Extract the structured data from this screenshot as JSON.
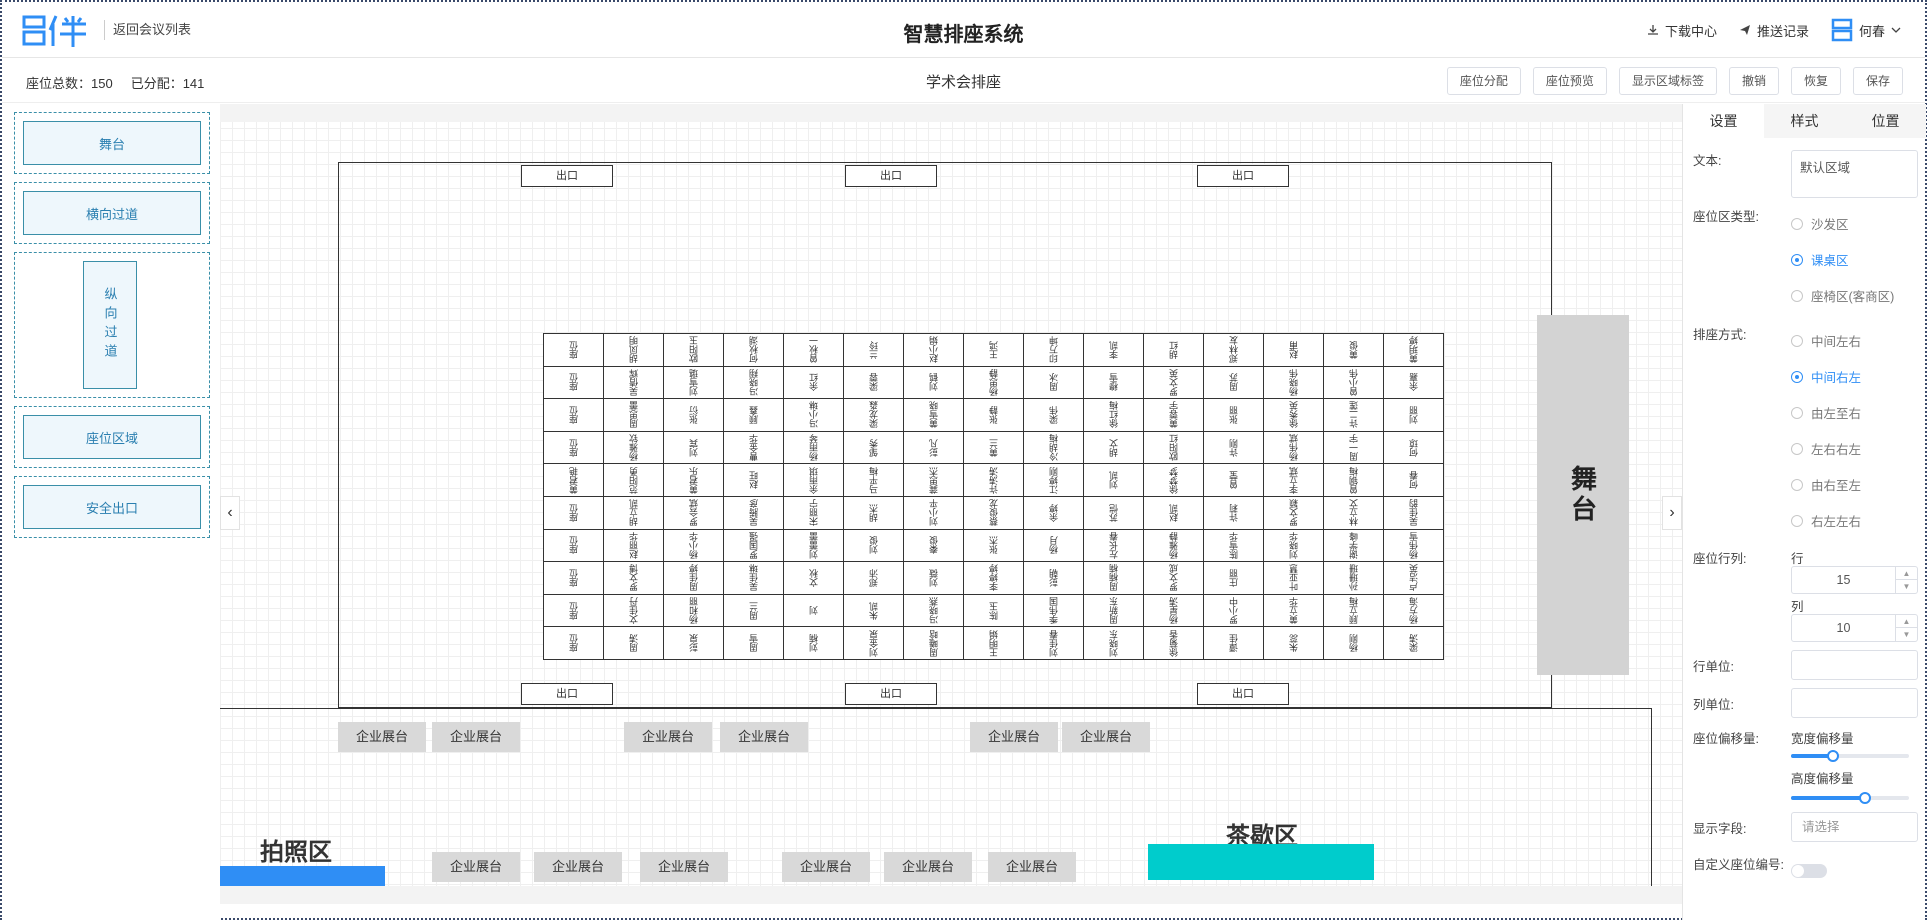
{
  "header": {
    "back_label": "返回会议列表",
    "title": "智慧排座系统",
    "download_label": "下载中心",
    "push_label": "推送记录",
    "user_name": "何春",
    "logo_text": "吕伴"
  },
  "toolbar": {
    "total_label": "座位总数：150",
    "assigned_label": "已分配：141",
    "sub_title": "学术会排座",
    "buttons": [
      "座位分配",
      "座位预览",
      "显示区域标签",
      "撤销",
      "恢复",
      "保存"
    ]
  },
  "components": {
    "stage": "舞台",
    "h_aisle": "横向过道",
    "v_aisle": "纵向过道",
    "seat_area": "座位区域",
    "safety_exit": "安全出口"
  },
  "canvas": {
    "exit_label": "出口",
    "stage_label": "舞台",
    "booth_label": "企业展台",
    "photo_zone": "拍照区",
    "tea_zone": "茶歇区",
    "seat_rows": [
      [
        "座位",
        "胡凤明",
        "欧阳玉",
        "何秋湖",
        "曾秋一",
        "兰玲",
        "赵小娟",
        "王鸿",
        "印万坤",
        "李凯",
        "胡红",
        "郑林友",
        "赵甫",
        "黄俊",
        "黄玥婷"
      ],
      [
        "座位",
        "吴倩辉",
        "刘雪璐",
        "冯晓翔",
        "余红",
        "梁蓉",
        "刘鹤",
        "杨思静",
        "周冰",
        "穆雪",
        "罗文英",
        "周苏",
        "杨晓伟",
        "曾小伟",
        "余嘉"
      ],
      [
        "座位",
        "周思蕾",
        "张衍",
        "顾鑫",
        "冯小琳",
        "梁龙淼",
        "黄雪晓",
        "张静",
        "梁伟",
        "徐红梅",
        "黄蓉宇",
        "张丽",
        "徐秀英",
        "许二莲",
        "刘丽"
      ],
      [
        "座位",
        "杨雅钦",
        "刘宾",
        "曹金华",
        "杨雨琴",
        "邹秀",
        "彭凡",
        "黄兰",
        "冷胡梅",
        "胡文",
        "欧阳红",
        "许刚",
        "杨伟斌",
        "周一宇",
        "何琼"
      ],
      [
        "黄君艳",
        "范阳勇",
        "黄君乐",
        "赵旺",
        "余雨琪",
        "马平梅",
        "龚思杰",
        "许涛涛",
        "江婷刚",
        "刘凯",
        "徐梦梦",
        "曾莹",
        "李立斌",
        "曾钢梅",
        "何春"
      ],
      [
        "座位",
        "胡立凯",
        "罗会斌",
        "吴腾彦",
        "宋丽宁",
        "胡杰",
        "刘小平",
        "蔡俊龙",
        "余婷",
        "苏恺",
        "赵凯",
        "许莉",
        "罗文颖",
        "林立文",
        "吴佳韵"
      ],
      [
        "座位",
        "赵丽华",
        "杨小华",
        "罗国强",
        "刘蕾蕾",
        "刘俊",
        "秦俊",
        "张杰",
        "杨月",
        "左长春",
        "杨雅静",
        "陈雪华",
        "刘晓华",
        "谢学峰",
        "杨伟雪"
      ],
      [
        "座位",
        "罗文博",
        "周佳婷",
        "吴佳琳",
        "文秋",
        "郑沛",
        "刘薇",
        "李婷婷",
        "彭朝",
        "周楠楠",
        "罗文成",
        "庄丽",
        "叶亚慧",
        "孙珊珊",
        "卢洁英"
      ],
      [
        "座位",
        "文佳丹",
        "杨和丽",
        "周兰",
        "刘",
        "朱凯",
        "冯晓燕",
        "陈玉",
        "季伟国",
        "周新东",
        "杨星涛",
        "罗小中",
        "黄立华",
        "顾立梅",
        "杨方海"
      ],
      [
        "座位",
        "周涛",
        "彭泉",
        "周雪",
        "刘楠",
        "刘金泉",
        "周曦晗",
        "王明娟",
        "刘佳春",
        "刘晓东",
        "徐菊香",
        "谭佳",
        "朱蕊",
        "杨刚",
        "梁涛"
      ]
    ]
  },
  "right_panel": {
    "tabs": [
      "设置",
      "样式",
      "位置"
    ],
    "text_label": "文本:",
    "text_value": "默认区域",
    "area_type_label": "座位区类型:",
    "area_types": [
      "沙发区",
      "课桌区",
      "座椅区(客商区)"
    ],
    "area_type_selected": 1,
    "seating_label": "排座方式:",
    "seating_modes": [
      "中间左右",
      "中间右左",
      "由左至右",
      "左右右左",
      "由右至左",
      "右左左右"
    ],
    "seating_selected": 1,
    "row_col_label": "座位行列:",
    "row_label": "行",
    "row_value": "15",
    "col_label": "列",
    "col_value": "10",
    "row_unit_label": "行单位:",
    "col_unit_label": "列单位:",
    "offset_label": "座位偏移量:",
    "width_offset_label": "宽度偏移量",
    "width_offset": 0.36,
    "height_offset_label": "高度偏移量",
    "height_offset": 0.63,
    "display_field_label": "显示字段:",
    "display_field_placeholder": "请选择",
    "custom_number_label": "自定义座位编号:",
    "custom_number_on": false
  },
  "colors": {
    "accent": "#2f8ef5",
    "component_border": "#3a8fa8",
    "tea_zone": "#00cccc",
    "stage_gray": "#d3d3d3"
  }
}
